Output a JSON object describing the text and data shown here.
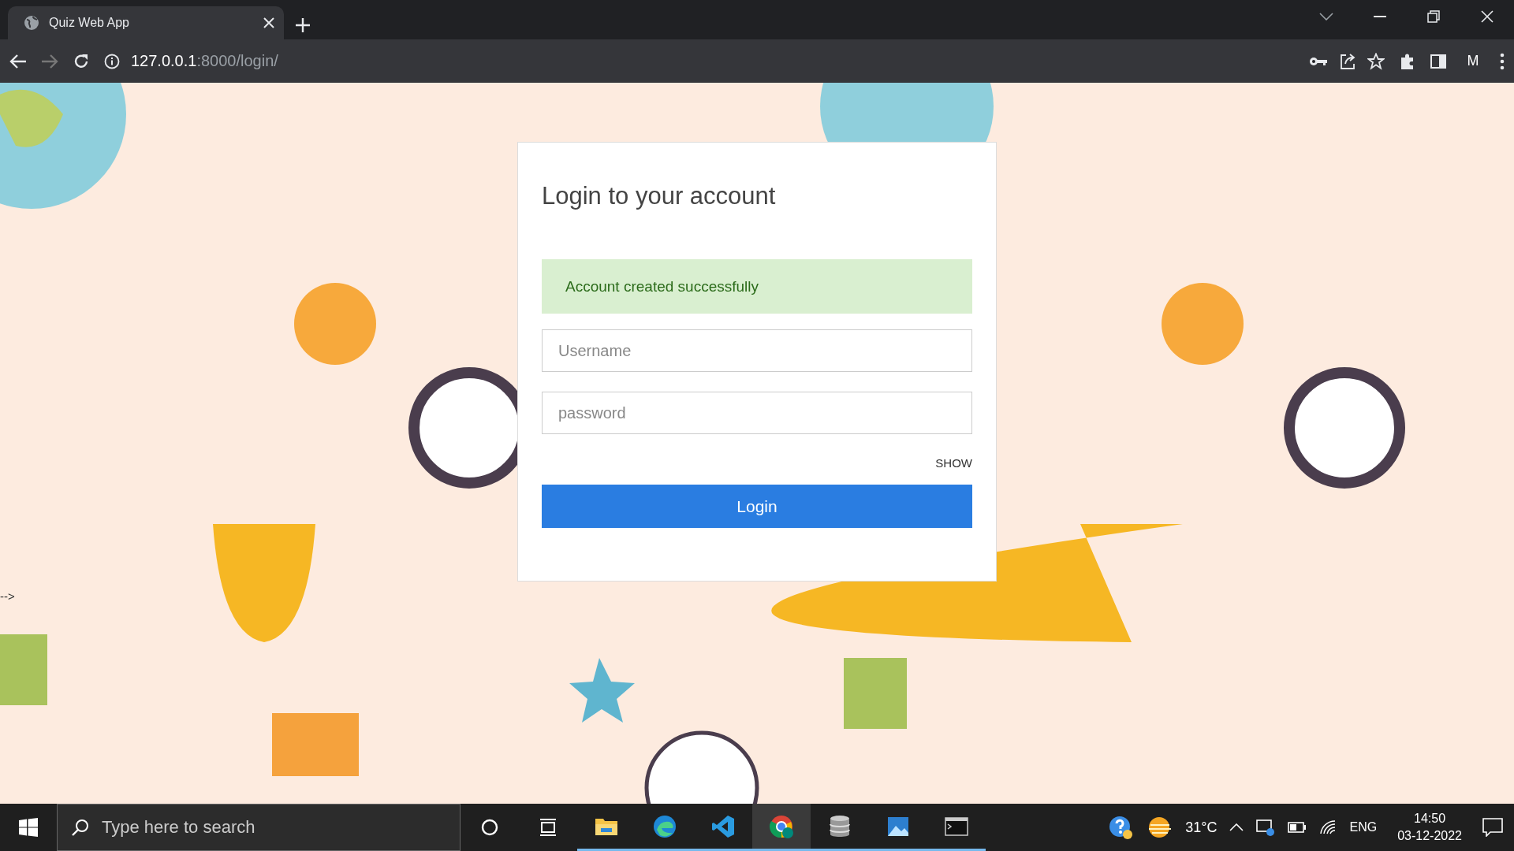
{
  "browser": {
    "tabs": [
      {
        "title": "Quiz Web App",
        "selected": true
      }
    ],
    "address": {
      "host": "127.0.0.1",
      "path": ":8000/login/"
    },
    "profile_initial": "M"
  },
  "page": {
    "stray_text": "-->",
    "login": {
      "title": "Login to your account",
      "alert": {
        "kind": "success",
        "text": "Account created successfully"
      },
      "fields": [
        {
          "placeholder": "Username"
        },
        {
          "placeholder": "password"
        }
      ],
      "show_toggle": "SHOW",
      "submit": "Login"
    }
  },
  "taskbar": {
    "search_placeholder": "Type here to search",
    "apps": [
      {
        "kind": "explorer",
        "selected": false
      },
      {
        "kind": "edge",
        "selected": false
      },
      {
        "kind": "code",
        "selected": false
      },
      {
        "kind": "chrome",
        "selected": true
      },
      {
        "kind": "database",
        "selected": false
      },
      {
        "kind": "photos",
        "selected": false
      },
      {
        "kind": "terminal",
        "selected": false
      }
    ],
    "weather": "31°C",
    "language": "ENG",
    "time": "14:50",
    "date": "03-12-2022"
  }
}
